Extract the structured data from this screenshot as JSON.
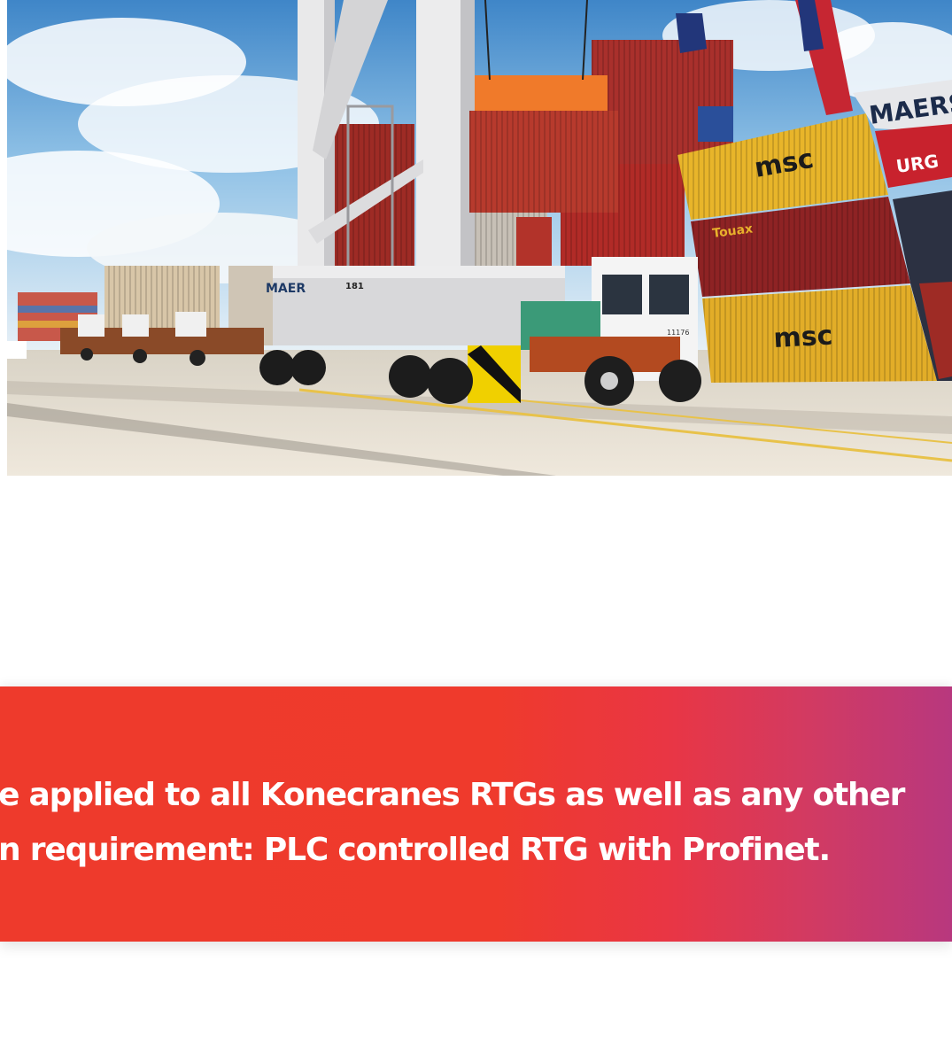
{
  "hero": {
    "image_subject": "container-terminal-photo",
    "brand_markings": {
      "msc_top": "msc",
      "msc_bottom": "msc",
      "touax": "Touax",
      "maersk": "MAERS",
      "maersk_small": "MAER",
      "hamburg": "URG",
      "truck_number": "11176",
      "crane_number": "181"
    }
  },
  "banner": {
    "line1": "e applied to all Konecranes RTGs as well as any other",
    "line2": "n requirement: PLC controlled RTG with Profinet."
  },
  "colors": {
    "banner_red": "#ee3a2c",
    "banner_magenta": "#b8387e",
    "banner_text": "#ffffff"
  }
}
